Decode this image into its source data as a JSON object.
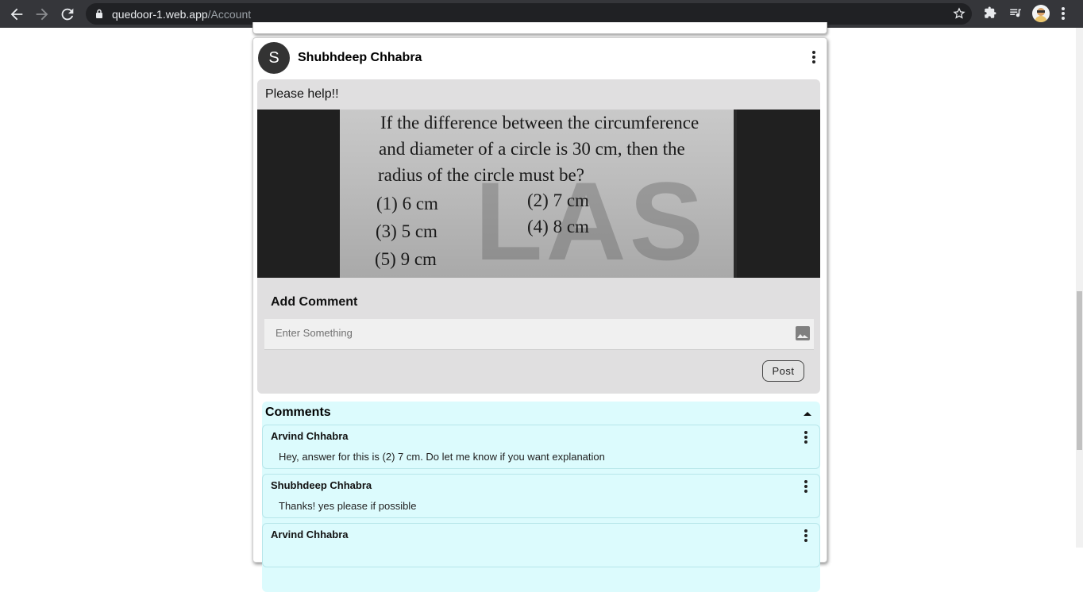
{
  "browser": {
    "url_host": "quedoor-1.web.app",
    "url_path": "/Account"
  },
  "post": {
    "avatar_letter": "S",
    "author": "Shubhdeep Chhabra",
    "text": "Please help!!",
    "image_text": [
      "If the difference between the circumference",
      "and diameter of a circle is 30 cm, then the",
      "radius of the circle must be?",
      "(1) 6 cm",
      "(2) 7 cm",
      "(3) 5 cm",
      "(4) 8 cm",
      "(5) 9 cm"
    ]
  },
  "add_comment": {
    "title": "Add Comment",
    "placeholder": "Enter Something",
    "post_label": "Post"
  },
  "comments": {
    "title": "Comments",
    "items": [
      {
        "author": "Arvind Chhabra",
        "text": "Hey, answer for this is (2) 7 cm. Do let me know if you want explanation"
      },
      {
        "author": "Shubhdeep Chhabra",
        "text": "Thanks! yes please if possible"
      },
      {
        "author": "Arvind Chhabra",
        "text": ""
      }
    ]
  }
}
